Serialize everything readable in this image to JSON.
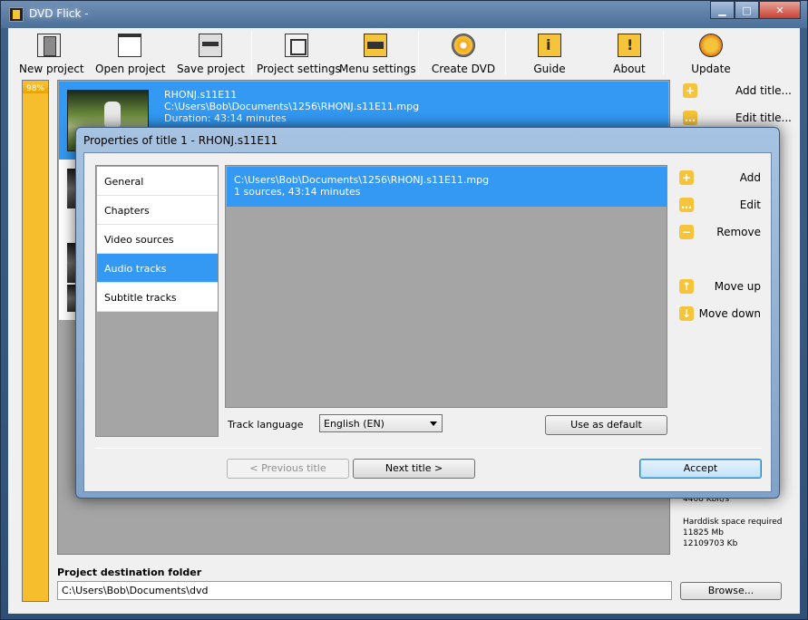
{
  "window": {
    "title": "DVD Flick -",
    "minimize": "▁",
    "maximize": "□",
    "close": "✕"
  },
  "toolbar": {
    "new_project": "New project",
    "open_project": "Open project",
    "save_project": "Save project",
    "project_settings": "Project settings",
    "menu_settings": "Menu settings",
    "create_dvd": "Create DVD",
    "guide": "Guide",
    "about": "About",
    "update": "Update"
  },
  "usage": {
    "percent_label": "98%",
    "fill_fraction": 0.98
  },
  "title_item": {
    "name": "RHONJ.s11E11",
    "path": "C:\\Users\\Bob\\Documents\\1256\\RHONJ.s11E11.mpg",
    "duration": "Duration: 43:14 minutes"
  },
  "side_buttons": {
    "add_title": "Add title...",
    "edit_title": "Edit title...",
    "add_icon": "+",
    "edit_icon": "…"
  },
  "info": {
    "bitrate": "4408 Kbit/s",
    "harddisk_label": "Harddisk space required",
    "harddisk_mb": "11825 Mb",
    "harddisk_kb": "12109703 Kb"
  },
  "destination": {
    "label": "Project destination folder",
    "value": "C:\\Users\\Bob\\Documents\\dvd",
    "browse": "Browse..."
  },
  "dialog": {
    "title": "Properties of title 1 - RHONJ.s11E11",
    "nav": [
      "General",
      "Chapters",
      "Video sources",
      "Audio tracks",
      "Subtitle tracks"
    ],
    "active_nav": "Audio tracks",
    "track": {
      "path": "C:\\Users\\Bob\\Documents\\1256\\RHONJ.s11E11.mpg",
      "summary": "1 sources, 43:14 minutes"
    },
    "track_language_label": "Track language",
    "track_language_value": "English (EN)",
    "use_as_default": "Use as default",
    "side": {
      "add": "Add",
      "edit": "Edit",
      "remove": "Remove",
      "move_up": "Move up",
      "move_down": "Move down",
      "add_icon": "+",
      "edit_icon": "…",
      "remove_icon": "−",
      "up_icon": "↑",
      "down_icon": "↓"
    },
    "previous_title": "< Previous title",
    "next_title": "Next title >",
    "accept": "Accept"
  },
  "colors": {
    "selection": "#3399f3",
    "accent_yellow": "#f6c43a",
    "list_background": "#a5a5a5"
  }
}
